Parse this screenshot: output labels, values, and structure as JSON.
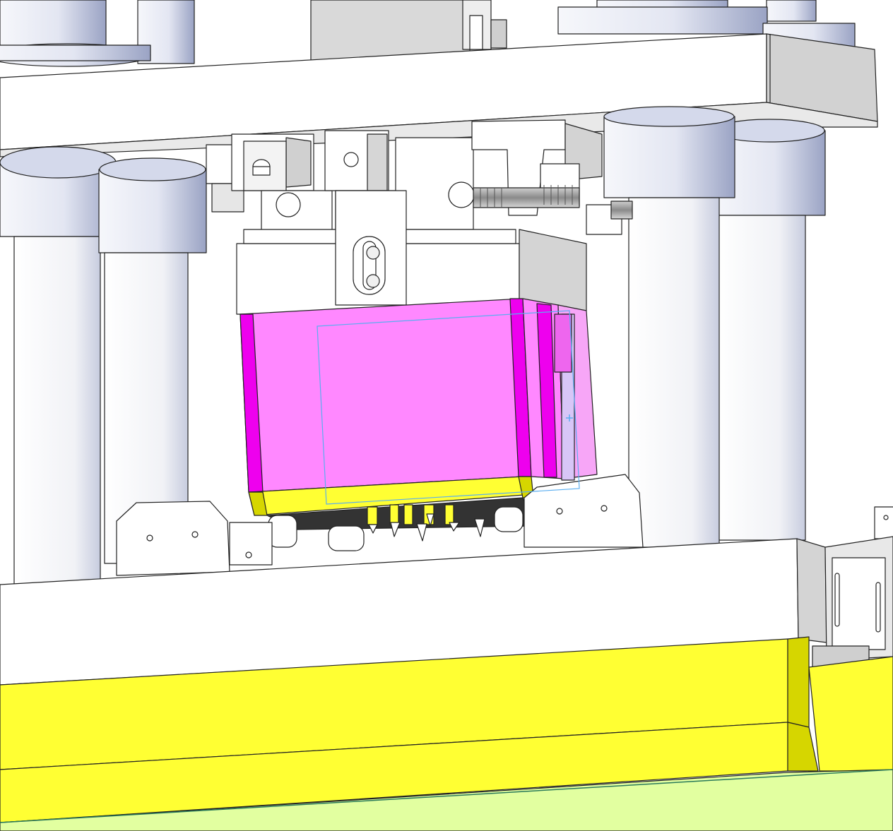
{
  "viewport": {
    "background": "#ffffff"
  },
  "colors": {
    "white_face": "#ffffff",
    "gray_face": "#d8d8d8",
    "dark_gray_face": "#bdbdbd",
    "edge": "#222222",
    "cylinder_light": "#f4f6fb",
    "cylinder_shadow": "#9aa3c4",
    "magenta_face": "#ff88ff",
    "magenta_side": "#ee00ee",
    "yellow_face": "#ffff33",
    "yellow_side": "#d6d600",
    "green_floor": "#e2ffa0",
    "selection_box": "#5aaef0"
  },
  "icons": {
    "origin_marker": "crosshair-icon"
  }
}
